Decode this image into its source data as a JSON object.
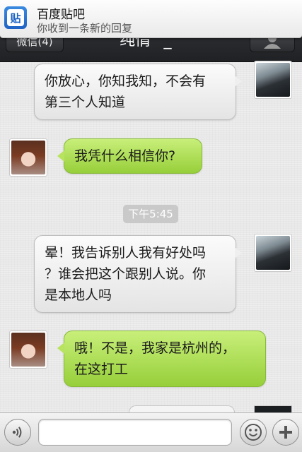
{
  "notification": {
    "app_name": "百度贴吧",
    "message": "你收到一条新的回复",
    "icon_char": "贴",
    "icon": "tieba-app-icon"
  },
  "header": {
    "back_label": "微信(4)",
    "title": "纯情^_^",
    "profile_icon": "person-icon"
  },
  "messages": [
    {
      "sender": "self",
      "text_lines": [
        "你放心，你知我知，不会有",
        "第三个人知道"
      ]
    },
    {
      "sender": "other",
      "text_lines": [
        "我凭什么相信你?"
      ]
    },
    {
      "sender": "self",
      "text_lines": [
        "晕！我告诉别人我有好处吗",
        "？谁会把这个跟别人说。你",
        "是本地人吗"
      ]
    },
    {
      "sender": "other",
      "text_lines": [
        "哦！不是，我家是杭州的，",
        "在这打工"
      ]
    }
  ],
  "timestamp": "下午5:45",
  "input": {
    "placeholder": "",
    "voice_icon": "voice-icon",
    "emoji_icon": "emoji-icon",
    "add_icon": "plus-icon"
  },
  "colors": {
    "bubble_self": "#efefef",
    "bubble_other": "#a6d94a",
    "titlebar": "#2a2c2f"
  }
}
